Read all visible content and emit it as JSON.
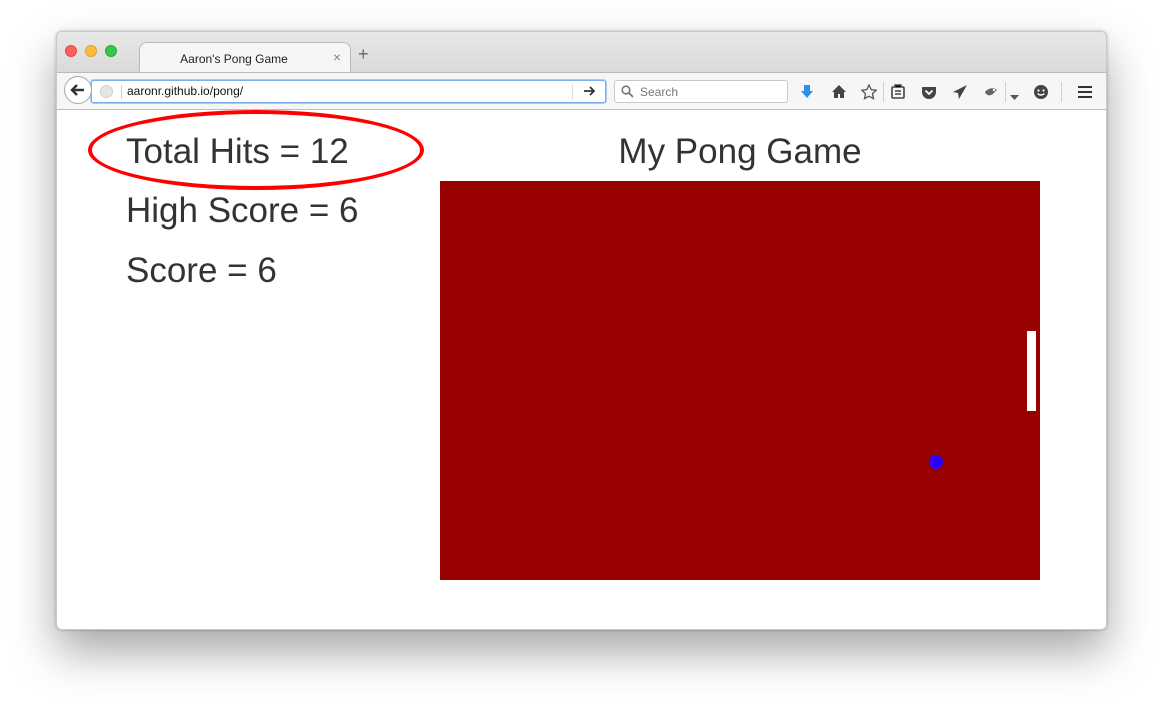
{
  "tab": {
    "title": "Aaron's Pong Game",
    "close_glyph": "×",
    "new_tab_glyph": "+"
  },
  "nav": {
    "url": "aaronr.github.io/pong/",
    "search_placeholder": "Search"
  },
  "toolbar_icons": [
    "download-icon",
    "home-icon",
    "bookmark-star-icon",
    "reading-list-icon",
    "pocket-icon",
    "send-icon",
    "extension-icon",
    "dropdown-icon",
    "emoji-icon",
    "menu-icon"
  ],
  "stats": {
    "total_hits": "Total Hits = 12",
    "high_score": "High Score = 6",
    "score": "Score = 6"
  },
  "game": {
    "title": "My Pong Game"
  },
  "colors": {
    "court": "#990000",
    "paddle": "#ffffff",
    "ball": "#2b00ff",
    "highlight_ellipse": "#ff0000"
  }
}
